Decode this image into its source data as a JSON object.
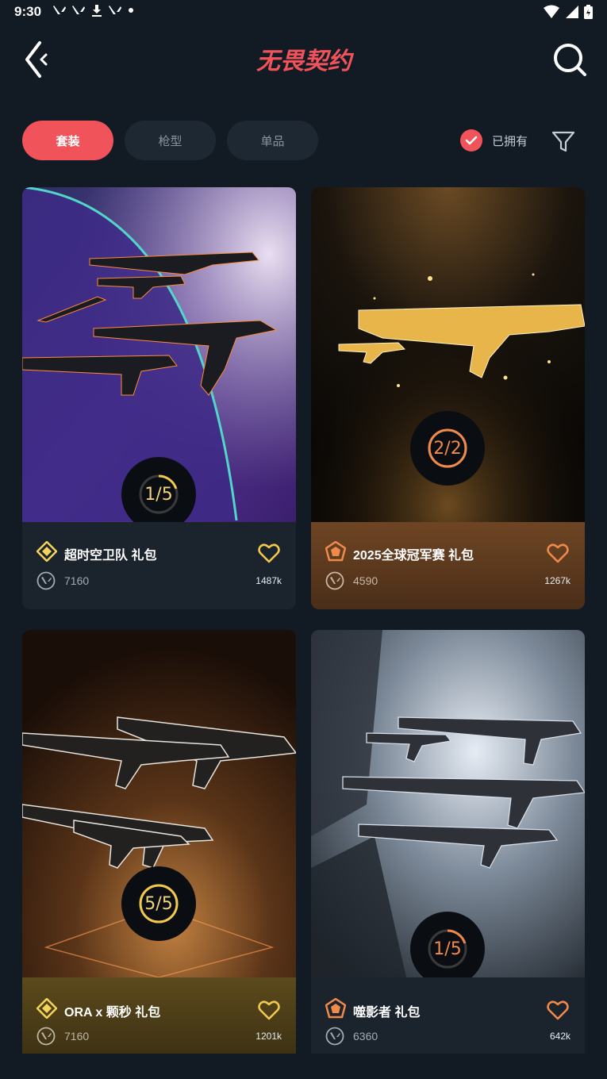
{
  "status_bar": {
    "time": "9:30",
    "notification_icons": [
      "valorant-icon",
      "valorant-icon",
      "download-icon",
      "valorant-icon",
      "dot-icon"
    ],
    "right_icons": [
      "wifi-icon",
      "signal-icon",
      "battery-icon"
    ]
  },
  "header": {
    "title": "无畏契约",
    "back_icon": "back-arrow-icon",
    "search_icon": "search-icon"
  },
  "tabs": [
    {
      "label": "套装",
      "active": true
    },
    {
      "label": "枪型",
      "active": false
    },
    {
      "label": "单品",
      "active": false
    }
  ],
  "owned_filter": {
    "label": "已拥有",
    "checked": true
  },
  "filter_icon": "filter-funnel-icon",
  "cards": [
    {
      "title": "超时空卫队 礼包",
      "price": "7160",
      "likes": "1487k",
      "progress": "1/5",
      "progress_fraction": 0.2,
      "tier": "premium-diamond-icon",
      "tier_color": "#f2d35b",
      "footer_color": "#1b232d"
    },
    {
      "title": "2025全球冠军赛 礼包",
      "price": "4590",
      "likes": "1267k",
      "progress": "2/2",
      "progress_fraction": 1.0,
      "tier": "exclusive-pentagon-icon",
      "tier_color": "#f08a4b",
      "footer_color": "#6e4524"
    },
    {
      "title": "ORA x 颗秒 礼包",
      "price": "7160",
      "likes": "1201k",
      "progress": "5/5",
      "progress_fraction": 1.0,
      "tier": "premium-diamond-icon",
      "tier_color": "#f2d35b",
      "footer_color": "#5c4a1c"
    },
    {
      "title": "噬影者 礼包",
      "price": "6360",
      "likes": "642k",
      "progress": "1/5",
      "progress_fraction": 0.2,
      "tier": "exclusive-pentagon-icon",
      "tier_color": "#f08a4b",
      "footer_color": "#1b232d"
    }
  ],
  "colors": {
    "background": "#121a24",
    "accent": "#f0535a",
    "tab_inactive": "#1e2833",
    "heart": "#f2c94c"
  }
}
